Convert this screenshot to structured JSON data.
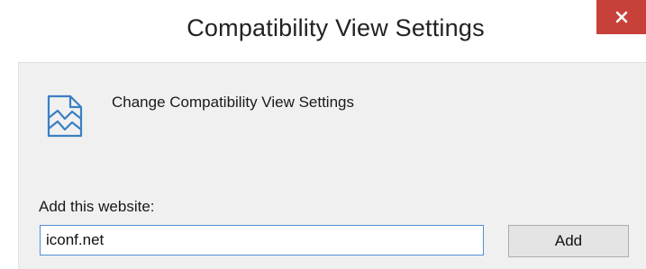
{
  "window": {
    "title": "Compatibility View Settings",
    "close_icon": "close-icon",
    "close_color": "#c7403a"
  },
  "header": {
    "icon": "compatibility-view-icon",
    "text": "Change Compatibility View Settings"
  },
  "add_site": {
    "label": "Add this website:",
    "value": "iconf.net",
    "button_label": "Add"
  }
}
